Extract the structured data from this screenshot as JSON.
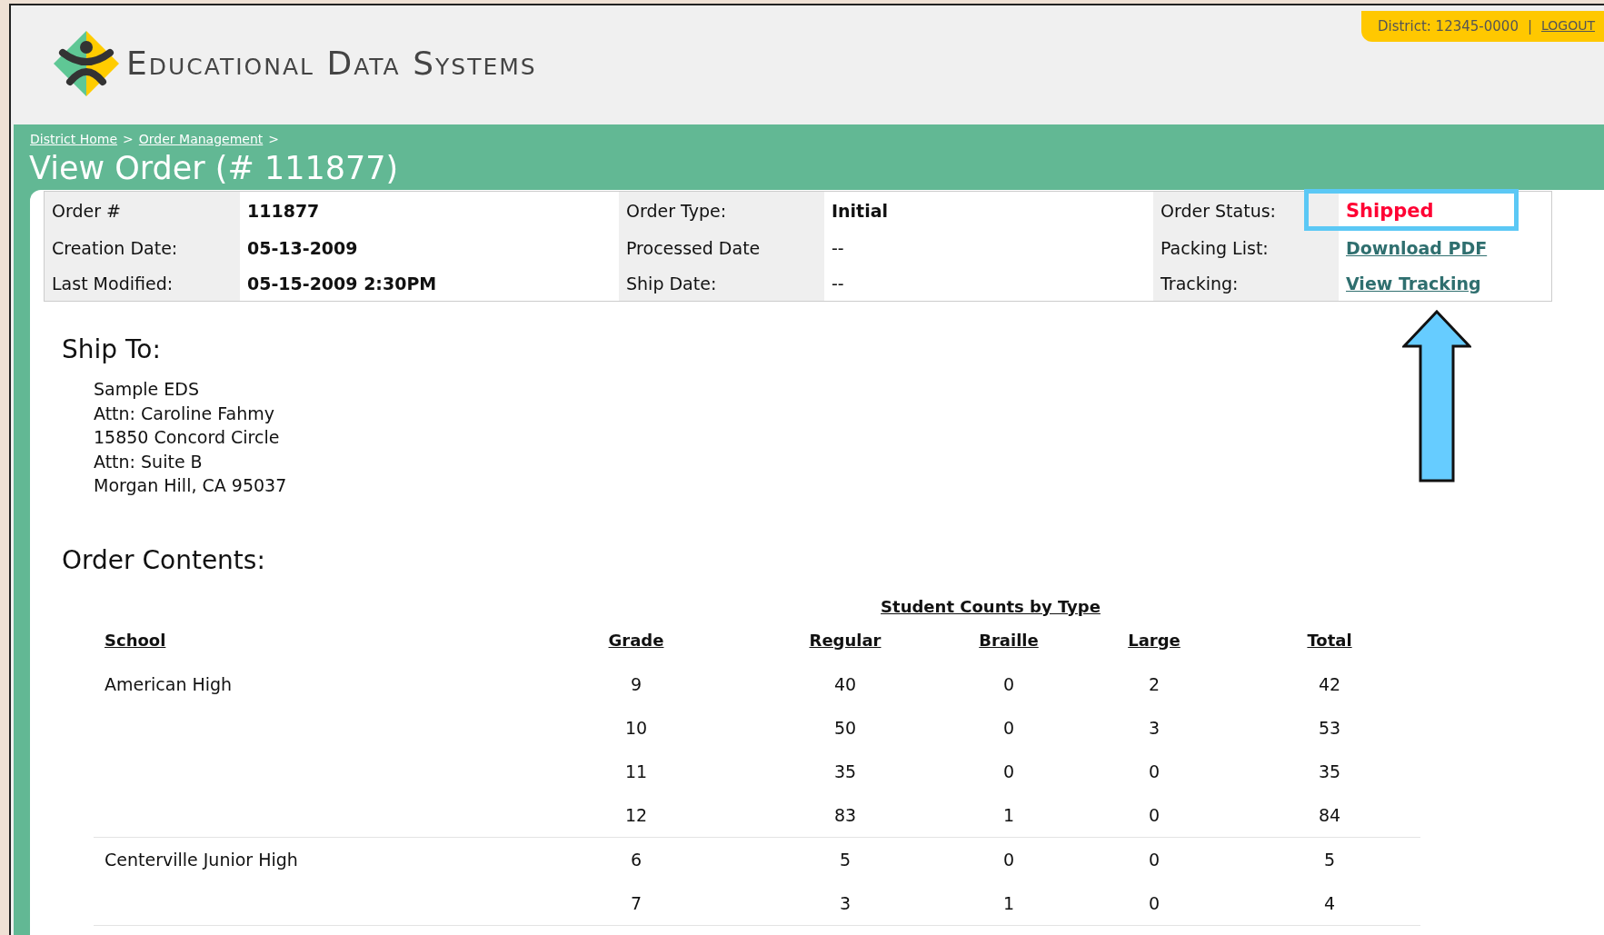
{
  "header": {
    "logo_text": "Educational Data Systems",
    "district": "District: 12345-0000",
    "separator": "|",
    "logout": "LOGOUT"
  },
  "breadcrumbs": [
    {
      "label": "District Home",
      "separator": ">"
    },
    {
      "label": "Order Management",
      "separator": ">"
    }
  ],
  "title": "View Order (# 111877)",
  "order_info": [
    [
      {
        "label": "Order #",
        "value": "111877",
        "kind": "text"
      },
      {
        "label": "Order Type:",
        "value": "Initial",
        "kind": "text"
      },
      {
        "label": "Order Status:",
        "value": "Shipped",
        "kind": "status"
      }
    ],
    [
      {
        "label": "Creation Date:",
        "value": "05-13-2009",
        "kind": "text"
      },
      {
        "label": "Processed Date",
        "value": "--",
        "kind": "plain"
      },
      {
        "label": "Packing List:",
        "value": "Download PDF",
        "kind": "link"
      }
    ],
    [
      {
        "label": "Last Modified:",
        "value": "05-15-2009 2:30PM",
        "kind": "text"
      },
      {
        "label": "Ship Date:",
        "value": "--",
        "kind": "plain"
      },
      {
        "label": "Tracking:",
        "value": "View Tracking",
        "kind": "link"
      }
    ]
  ],
  "ship_to": {
    "heading": "Ship To:",
    "lines": [
      "Sample EDS",
      "Attn: Caroline Fahmy",
      "15850 Concord Circle",
      "Attn: Suite B",
      "Morgan Hill, CA 95037"
    ]
  },
  "order_contents": {
    "heading": "Order Contents:",
    "group_heading": "Student Counts by Type",
    "columns": [
      "School",
      "Grade",
      "Regular",
      "Braille",
      "Large",
      "Total"
    ],
    "schools": [
      {
        "school": "American High",
        "rows": [
          [
            "9",
            "40",
            "0",
            "2",
            "42"
          ],
          [
            "10",
            "50",
            "0",
            "3",
            "53"
          ],
          [
            "11",
            "35",
            "0",
            "0",
            "35"
          ],
          [
            "12",
            "83",
            "1",
            "0",
            "84"
          ]
        ]
      },
      {
        "school": "Centerville Junior High",
        "rows": [
          [
            "6",
            "5",
            "0",
            "0",
            "5"
          ],
          [
            "7",
            "3",
            "1",
            "0",
            "4"
          ]
        ]
      }
    ]
  }
}
